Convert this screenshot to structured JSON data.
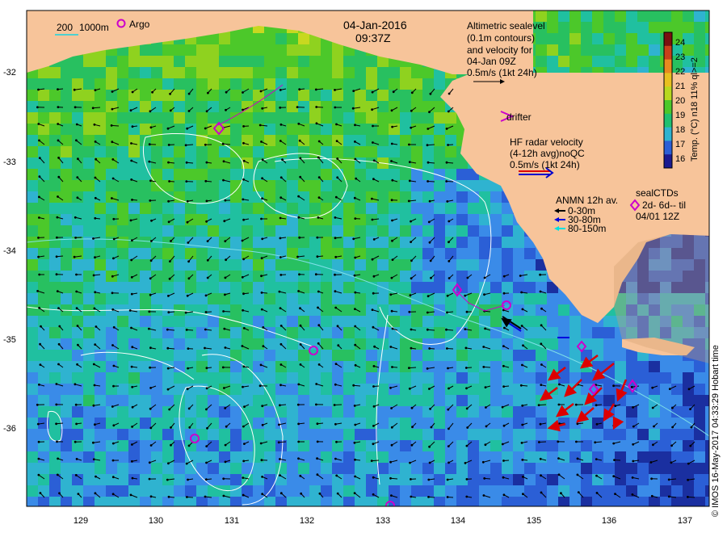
{
  "title": {
    "date": "04-Jan-2016",
    "time": "09:37Z"
  },
  "scale_bar": {
    "label_a": "200",
    "label_b": "1000m"
  },
  "argo_legend": {
    "label": "Argo"
  },
  "altimetry_legend": {
    "lines": [
      "Altimetric sealevel",
      "(0.1m contours)",
      "and velocity for",
      "04-Jan 09Z",
      "0.5m/s (1kt 24h)"
    ]
  },
  "drifter_legend": {
    "label": "drifter"
  },
  "hf_radar_legend": {
    "lines": [
      "HF radar velocity",
      "(4-12h avg)noQC",
      "0.5m/s (1kt 24h)"
    ]
  },
  "anmn_legend": {
    "title": "ANMN 12h av.",
    "items": [
      {
        "label": "0-30m",
        "color": "#000000"
      },
      {
        "label": "30-80m",
        "color": "#0000dd"
      },
      {
        "label": "80-150m",
        "color": "#00e0e0"
      }
    ]
  },
  "sealctd_legend": {
    "title": "sealCTDs",
    "line1": "2d- 6d-- til",
    "line2": "04/01 12Z"
  },
  "colorbar": {
    "label": "Temp. (°C) n18 11% ql>=2",
    "ticks": [
      "24",
      "23",
      "22",
      "21",
      "20",
      "19",
      "18",
      "17",
      "16"
    ]
  },
  "axes": {
    "lon_ticks": [
      "129",
      "130",
      "131",
      "132",
      "133",
      "134",
      "135",
      "136",
      "137"
    ],
    "lat_ticks": [
      "-32",
      "-33",
      "-34",
      "-35",
      "-36"
    ]
  },
  "credit": "© IMOS 16-May-2017 04:33:29 Hobart time",
  "colors": {
    "land": "#f7c49a",
    "argo": "#cc00cc",
    "hf_radar": "#dd0000",
    "contour": "#ffffff"
  },
  "argo_count": 6
}
